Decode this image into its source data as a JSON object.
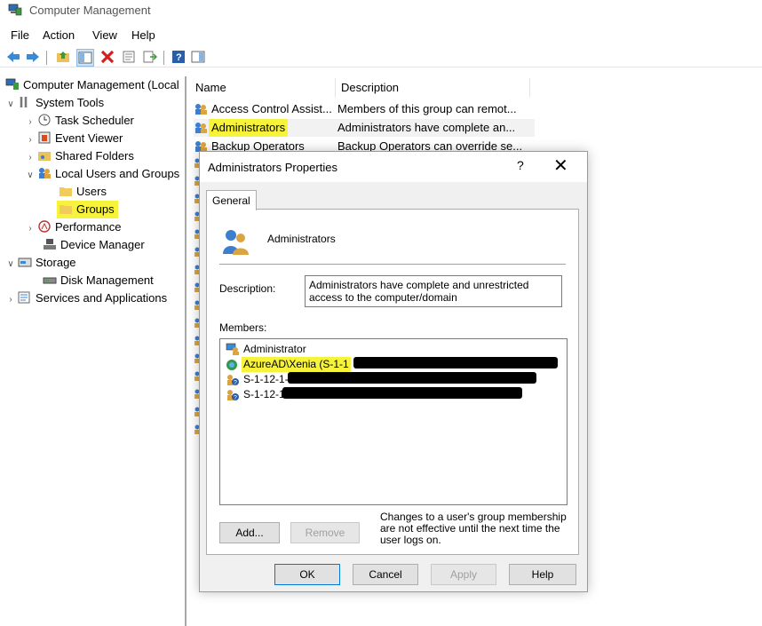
{
  "window": {
    "title": "Computer Management"
  },
  "menu": [
    "File",
    "Action",
    "View",
    "Help"
  ],
  "tree": {
    "root": "Computer Management (Local",
    "system_tools": "System Tools",
    "task_scheduler": "Task Scheduler",
    "event_viewer": "Event Viewer",
    "shared_folders": "Shared Folders",
    "local_users_groups": "Local Users and Groups",
    "users": "Users",
    "groups": "Groups",
    "performance": "Performance",
    "device_manager": "Device Manager",
    "storage": "Storage",
    "disk_management": "Disk Management",
    "services_apps": "Services and Applications"
  },
  "list": {
    "columns": {
      "name": "Name",
      "description": "Description"
    },
    "rows": [
      {
        "name": "Access Control Assist...",
        "description": "Members of this group can remot..."
      },
      {
        "name": "Administrators",
        "description": "Administrators have complete an..."
      },
      {
        "name": "Backup Operators",
        "description": "Backup Operators can override se..."
      }
    ]
  },
  "dialog": {
    "title": "Administrators Properties",
    "help": "?",
    "close": "✕",
    "tab": "General",
    "group_name": "Administrators",
    "description_label": "Description:",
    "description_value": "Administrators have complete and unrestricted access to the computer/domain",
    "members_label": "Members:",
    "members": [
      {
        "name": "Administrator"
      },
      {
        "name": "AzureAD\\Xenia (S-1-1"
      },
      {
        "name": "S-1-12-1-"
      },
      {
        "name": "S-1-12-1"
      }
    ],
    "add_button": "Add...",
    "remove_button": "Remove",
    "note": "Changes to a user's group membership are not effective until the next time the user logs on.",
    "ok_button": "OK",
    "cancel_button": "Cancel",
    "apply_button": "Apply",
    "help_button": "Help"
  },
  "colors": {
    "highlight": "#f7f23a",
    "default_button_border": "#0078d7"
  }
}
